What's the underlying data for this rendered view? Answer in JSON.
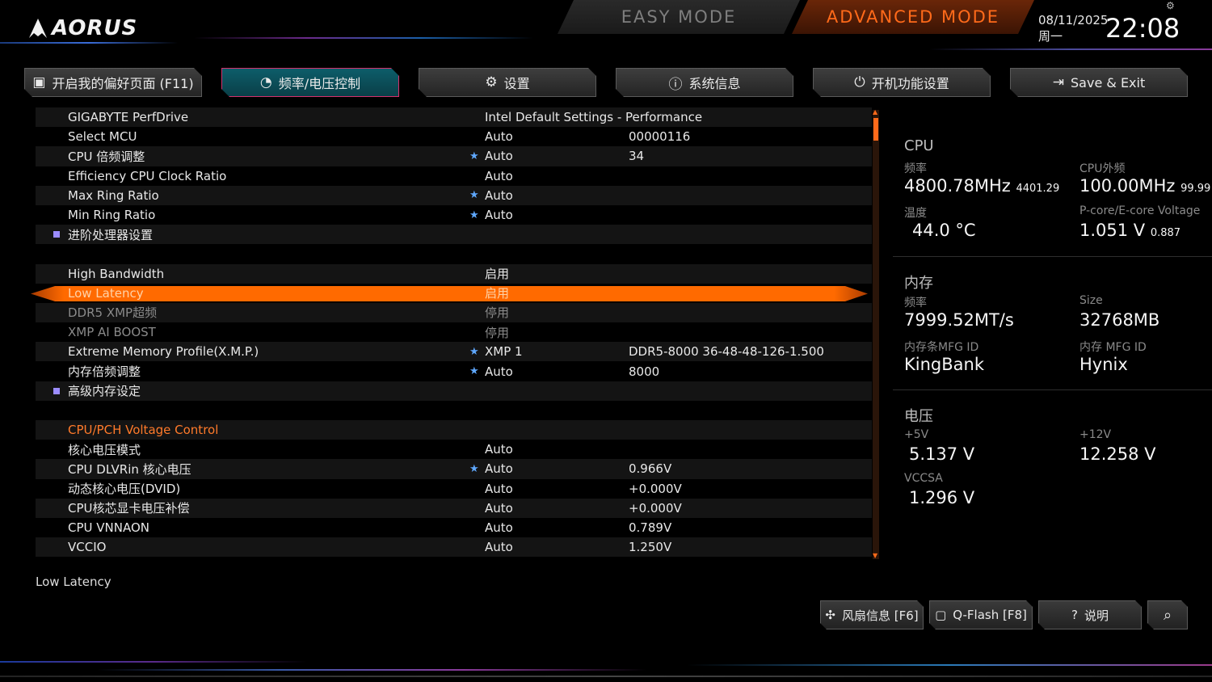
{
  "brand": {
    "logo_text": "AORUS"
  },
  "modes": {
    "easy": "EASY MODE",
    "advanced": "ADVANCED MODE"
  },
  "datetime": {
    "date": "08/11/2025",
    "weekday": "周一",
    "time": "22:08"
  },
  "tabs": [
    {
      "label": "开启我的偏好页面 (F11)",
      "icon": "star-page-icon"
    },
    {
      "label": "频率/电压控制",
      "icon": "speedometer-icon",
      "active": true
    },
    {
      "label": "设置",
      "icon": "gear-icon"
    },
    {
      "label": "系统信息",
      "icon": "info-icon"
    },
    {
      "label": "开机功能设置",
      "icon": "power-icon"
    },
    {
      "label": "Save & Exit",
      "icon": "exit-icon"
    }
  ],
  "settings": [
    {
      "label": "GIGABYTE PerfDrive",
      "value": "Intel Default Settings - Performance",
      "value2": "",
      "star": ""
    },
    {
      "label": "Select MCU",
      "value": "Auto",
      "value2": "00000116",
      "star": ""
    },
    {
      "label": "CPU 倍频调整",
      "value": "Auto",
      "value2": "34",
      "star": "★"
    },
    {
      "label": "Efficiency CPU Clock Ratio",
      "value": "Auto",
      "value2": "",
      "star": ""
    },
    {
      "label": "Max Ring Ratio",
      "value": "Auto",
      "value2": "",
      "star": "★"
    },
    {
      "label": "Min Ring Ratio",
      "value": "Auto",
      "value2": "",
      "star": "★"
    },
    {
      "label": "进阶处理器设置",
      "value": "",
      "value2": "",
      "star": ""
    },
    {
      "label": "",
      "value": "",
      "value2": "",
      "star": ""
    },
    {
      "label": "High Bandwidth",
      "value": "启用",
      "value2": "",
      "star": ""
    },
    {
      "label": "Low Latency",
      "value": "启用",
      "value2": "",
      "star": ""
    },
    {
      "label": "DDR5 XMP超频",
      "value": "停用",
      "value2": "",
      "star": ""
    },
    {
      "label": "XMP AI BOOST",
      "value": "停用",
      "value2": "",
      "star": ""
    },
    {
      "label": "Extreme Memory Profile(X.M.P.)",
      "value": "XMP 1",
      "value2": "DDR5-8000 36-48-48-126-1.500",
      "star": "★"
    },
    {
      "label": "内存倍频调整",
      "value": "Auto",
      "value2": "8000",
      "star": "★"
    },
    {
      "label": "高级内存设定",
      "value": "",
      "value2": "",
      "star": ""
    },
    {
      "label": "",
      "value": "",
      "value2": "",
      "star": ""
    },
    {
      "label": "CPU/PCH Voltage Control",
      "value": "",
      "value2": "",
      "star": ""
    },
    {
      "label": "核心电压模式",
      "value": "Auto",
      "value2": "",
      "star": ""
    },
    {
      "label": "CPU DLVRin 核心电压",
      "value": "Auto",
      "value2": "0.966V",
      "star": "★"
    },
    {
      "label": "动态核心电压(DVID)",
      "value": "Auto",
      "value2": "+0.000V",
      "star": ""
    },
    {
      "label": "CPU核芯显卡电压补偿",
      "value": "Auto",
      "value2": "+0.000V",
      "star": ""
    },
    {
      "label": "CPU VNNAON",
      "value": "Auto",
      "value2": "0.789V",
      "star": ""
    },
    {
      "label": "VCCIO",
      "value": "Auto",
      "value2": "1.250V",
      "star": ""
    }
  ],
  "help_text": "Low Latency",
  "info": {
    "cpu": {
      "title": "CPU",
      "freq_label": "频率",
      "freq": "4800.78MHz",
      "freq_sub": "4401.29",
      "bclk_label": "CPU外频",
      "bclk": "100.00MHz",
      "bclk_sub": "99.99",
      "temp_label": "温度",
      "temp": "44.0 °C",
      "volt_label": "P-core/E-core Voltage",
      "volt": "1.051 V",
      "volt_sub": "0.887"
    },
    "memory": {
      "title": "内存",
      "freq_label": "频率",
      "freq": "7999.52MT/s",
      "size_label": "Size",
      "size": "32768MB",
      "mfg_label": "内存条MFG ID",
      "mfg": "KingBank",
      "ic_label": "内存 MFG ID",
      "ic": "Hynix"
    },
    "voltage": {
      "title": "电压",
      "v5_label": "+5V",
      "v5": "5.137 V",
      "v12_label": "+12V",
      "v12": "12.258 V",
      "vccsa_label": "VCCSA",
      "vccsa": "1.296 V"
    }
  },
  "footer_buttons": [
    {
      "label": "风扇信息 [F6]",
      "icon": "fan-icon"
    },
    {
      "label": "Q-Flash [F8]",
      "icon": "chip-icon"
    },
    {
      "label": "说明",
      "icon": "help-icon"
    },
    {
      "label": "",
      "icon": "search-icon"
    }
  ]
}
